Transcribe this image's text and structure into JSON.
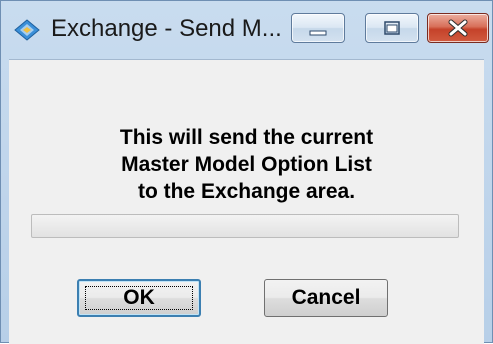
{
  "window": {
    "title": "Exchange - Send M...",
    "app_icon": "exchange-diamond-icon",
    "controls": {
      "minimize_icon": "minimize-icon",
      "maximize_icon": "maximize-icon",
      "close_icon": "close-icon"
    }
  },
  "dialog": {
    "message_lines": [
      "This will send the current",
      "Master Model Option List",
      "to the Exchange area."
    ],
    "progress": 0,
    "ok_label": "OK",
    "cancel_label": "Cancel"
  },
  "colors": {
    "title_bar": "#b7cfe8",
    "client_bg": "#f0f0f0",
    "close_button": "#c5422a",
    "icon_accent": "#3a8fd8"
  }
}
